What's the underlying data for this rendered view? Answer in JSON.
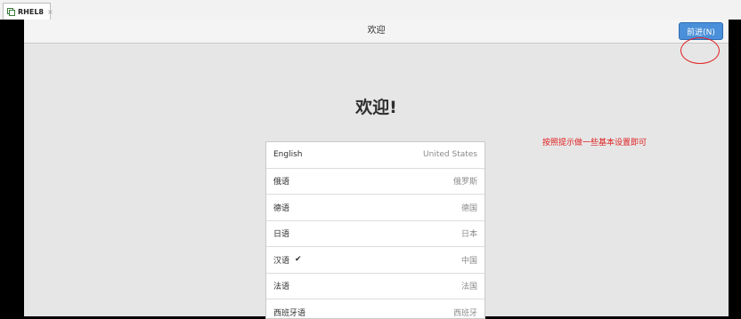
{
  "tab": {
    "label": "RHEL8",
    "close": "×"
  },
  "header": {
    "title": "欢迎",
    "next_button": "前进(N)"
  },
  "welcome": "欢迎!",
  "annotation": "按照提示做一些基本设置即可",
  "languages": [
    {
      "name": "English",
      "region": "United States",
      "check": ""
    },
    {
      "name": "俄语",
      "region": "俄罗斯",
      "check": ""
    },
    {
      "name": "德语",
      "region": "德国",
      "check": ""
    },
    {
      "name": "日语",
      "region": "日本",
      "check": ""
    },
    {
      "name": "汉语",
      "region": "中国",
      "check": "✔"
    },
    {
      "name": "法语",
      "region": "法国",
      "check": ""
    },
    {
      "name": "西班牙语",
      "region": "西班牙",
      "check": ""
    }
  ],
  "colors": {
    "accent": "#4a8fd9",
    "annotation": "#e02020"
  },
  "icons": {
    "tab": "vm-icon",
    "selected": "checkmark-icon"
  }
}
